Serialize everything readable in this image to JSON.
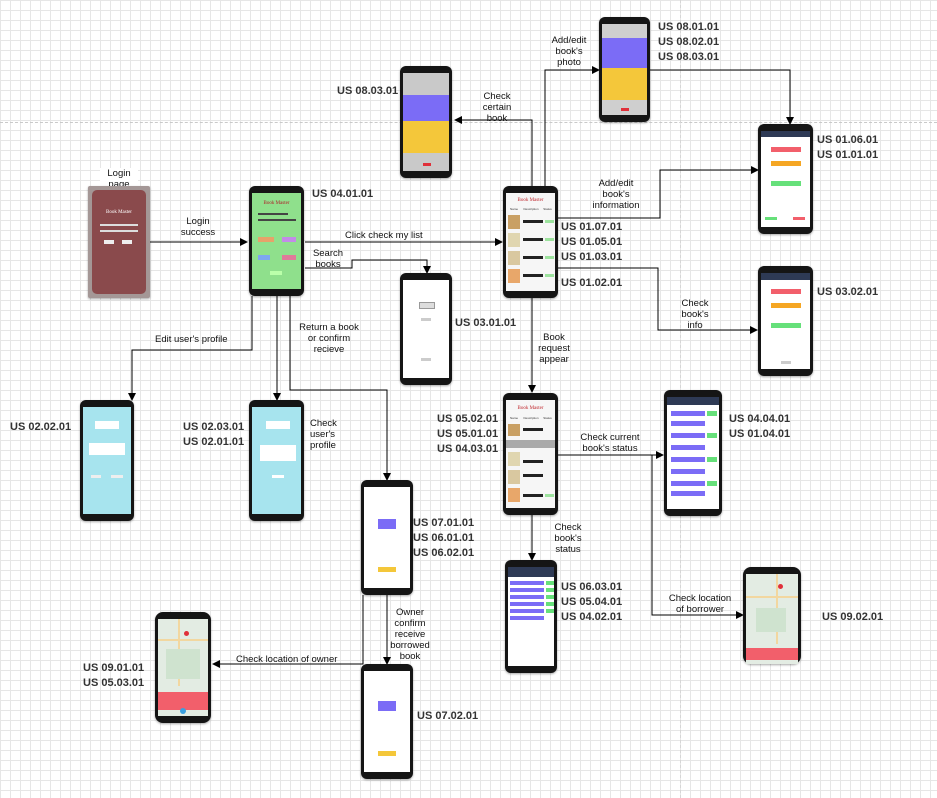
{
  "screens": {
    "login": {
      "caption": "Login page",
      "brand": "Book Master"
    },
    "home": {
      "brand": "Book Master",
      "us": [
        "US 04.01.01"
      ]
    },
    "my_books": {
      "brand": "Book Master",
      "columns": [
        "Name",
        "Description",
        "Status"
      ],
      "us": [
        "US 01.07.01",
        "US 01.05.01",
        "US 01.03.01",
        "US 01.02.01"
      ]
    },
    "book_requests": {
      "brand": "Book Master",
      "columns": [
        "Name",
        "Description",
        "Status"
      ],
      "us": [
        "US 05.02.01",
        "US 05.01.01",
        "US 04.03.01"
      ]
    },
    "book_view": {
      "us": [
        "US 08.03.01"
      ]
    },
    "photo_edit": {
      "us": [
        "US 08.01.01",
        "US 08.02.01",
        "US 08.03.01"
      ]
    },
    "book_info_edit": {
      "us": [
        "US 01.06.01",
        "US 01.01.01"
      ]
    },
    "book_info": {
      "us": [
        "US 03.02.01"
      ]
    },
    "search": {
      "us": [
        "US 03.01.01"
      ]
    },
    "edit_profile": {
      "us": [
        "US 02.02.01"
      ]
    },
    "user_profile": {
      "us": [
        "US 02.03.01",
        "US 02.01.01"
      ]
    },
    "return_confirm": {
      "us": [
        "US 07.01.01",
        "US 06.01.01",
        "US 06.02.01"
      ]
    },
    "owner_confirm": {
      "us": [
        "US 07.02.01"
      ]
    },
    "owner_map": {
      "us": [
        "US 09.01.01",
        "US 05.03.01"
      ]
    },
    "borrowed_status": {
      "us": [
        "US 06.03.01",
        "US 05.04.01",
        "US 04.02.01"
      ]
    },
    "current_status": {
      "us": [
        "US 04.04.01",
        "US 01.04.01"
      ]
    },
    "borrower_map": {
      "us": [
        "US 09.02.01"
      ]
    }
  },
  "edges": {
    "login_success": "Login success",
    "click_check_list": "Click check my list",
    "search_books": "Search books",
    "edit_profile": "Edit user's profile",
    "return_book": "Return a book or confirm recieve",
    "check_profile": "Check user's profile",
    "check_certain_book": "Check certain book",
    "add_edit_photo": "Add/edit book's photo",
    "add_edit_info": "Add/edit book's information",
    "check_book_info": "Check book's info",
    "book_request_appear": "Book request appear",
    "check_current_status": "Check current book's status",
    "check_book_status": "Check book's status",
    "check_location_borrower": "Check location of borrower",
    "check_location_owner": "Check location of owner",
    "owner_confirm_receive": "Owner confirm receive borrowed book"
  },
  "colors": {
    "purple": "#7b6cf6",
    "yellow": "#f4c73a",
    "green": "#66e07a",
    "red": "#f25f6b",
    "orange": "#f5a623",
    "cyan": "#a7e4ee",
    "maroon": "#8a4a4c"
  }
}
